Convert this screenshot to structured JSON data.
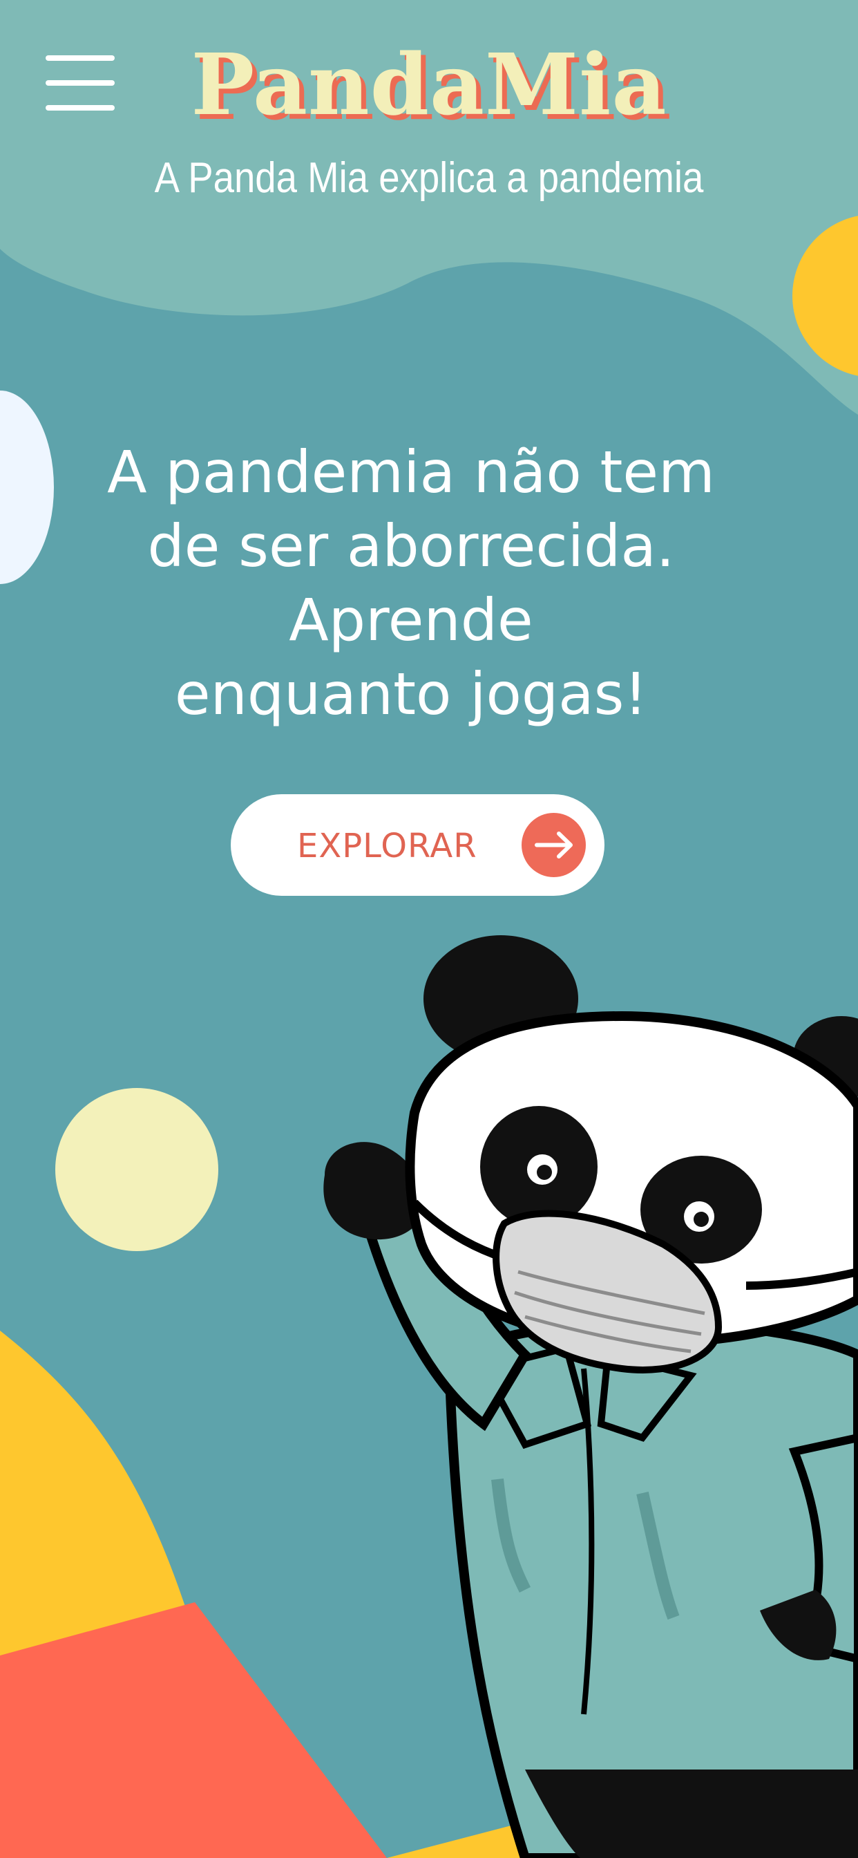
{
  "header": {
    "brand": "PandaMia",
    "tagline": "A Panda Mia explica a pandemia",
    "menu_icon": "hamburger-menu-icon"
  },
  "hero": {
    "headline": "A pandemia não tem\nde ser aborrecida.\nAprende\nenquanto jogas!",
    "cta_label": "EXPLORAR",
    "cta_icon": "arrow-right-icon"
  },
  "illustration": {
    "subject": "panda-mascot-icon"
  },
  "colors": {
    "background": "#5ea3ab",
    "top_band": "#7fbab6",
    "yellow": "#fec72e",
    "coral": "#ff6852",
    "cream": "#f3f1ba",
    "pale_blue": "#eef6ff",
    "brand_shadow": "#ec6b53"
  }
}
